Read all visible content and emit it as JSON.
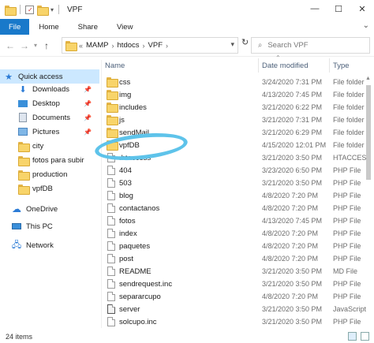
{
  "window": {
    "title": "VPF",
    "controls": {
      "minimize": "—",
      "maximize": "☐",
      "close": "✕"
    }
  },
  "ribbon": {
    "tabs": [
      "File",
      "Home",
      "Share",
      "View"
    ],
    "expand_icon": "chevron-down"
  },
  "address": {
    "back": "←",
    "forward": "→",
    "up": "↑",
    "breadcrumb_overflow": "«",
    "crumbs": [
      "MAMP",
      "htdocs",
      "VPF"
    ],
    "search_placeholder": "Search VPF"
  },
  "nav": {
    "items": [
      {
        "label": "Quick access",
        "icon": "star",
        "selected": true,
        "pinned": false
      },
      {
        "label": "Downloads",
        "icon": "download",
        "pinned": true
      },
      {
        "label": "Desktop",
        "icon": "desktop",
        "pinned": true
      },
      {
        "label": "Documents",
        "icon": "documents",
        "pinned": true
      },
      {
        "label": "Pictures",
        "icon": "pictures",
        "pinned": true
      },
      {
        "label": "city",
        "icon": "folder",
        "pinned": false
      },
      {
        "label": "fotos para subir",
        "icon": "folder",
        "pinned": false
      },
      {
        "label": "production",
        "icon": "folder",
        "pinned": false
      },
      {
        "label": "vpfDB",
        "icon": "folder",
        "pinned": false
      },
      {
        "label": "OneDrive",
        "icon": "cloud",
        "pinned": false
      },
      {
        "label": "This PC",
        "icon": "computer",
        "pinned": false
      },
      {
        "label": "Network",
        "icon": "network",
        "pinned": false
      }
    ]
  },
  "list": {
    "columns": {
      "name": "Name",
      "date": "Date modified",
      "type": "Type"
    },
    "files": [
      {
        "name": "css",
        "date": "3/24/2020 7:31 PM",
        "type": "File folder",
        "kind": "folder"
      },
      {
        "name": "img",
        "date": "4/13/2020 7:45 PM",
        "type": "File folder",
        "kind": "folder"
      },
      {
        "name": "includes",
        "date": "3/21/2020 6:22 PM",
        "type": "File folder",
        "kind": "folder"
      },
      {
        "name": "js",
        "date": "3/21/2020 7:31 PM",
        "type": "File folder",
        "kind": "folder"
      },
      {
        "name": "sendMail",
        "date": "3/21/2020 6:29 PM",
        "type": "File folder",
        "kind": "folder"
      },
      {
        "name": "vpfDB",
        "date": "4/15/2020 12:01 PM",
        "type": "File folder",
        "kind": "folder"
      },
      {
        "name": ".htaccess",
        "date": "3/21/2020 3:50 PM",
        "type": "HTACCESS",
        "kind": "file"
      },
      {
        "name": "404",
        "date": "3/23/2020 6:50 PM",
        "type": "PHP File",
        "kind": "file"
      },
      {
        "name": "503",
        "date": "3/21/2020 3:50 PM",
        "type": "PHP File",
        "kind": "file"
      },
      {
        "name": "blog",
        "date": "4/8/2020 7:20 PM",
        "type": "PHP File",
        "kind": "file"
      },
      {
        "name": "contactanos",
        "date": "4/8/2020 7:20 PM",
        "type": "PHP File",
        "kind": "file"
      },
      {
        "name": "fotos",
        "date": "4/13/2020 7:45 PM",
        "type": "PHP File",
        "kind": "file"
      },
      {
        "name": "index",
        "date": "4/8/2020 7:20 PM",
        "type": "PHP File",
        "kind": "file"
      },
      {
        "name": "paquetes",
        "date": "4/8/2020 7:20 PM",
        "type": "PHP File",
        "kind": "file"
      },
      {
        "name": "post",
        "date": "4/8/2020 7:20 PM",
        "type": "PHP File",
        "kind": "file"
      },
      {
        "name": "README",
        "date": "3/21/2020 3:50 PM",
        "type": "MD File",
        "kind": "file"
      },
      {
        "name": "sendrequest.inc",
        "date": "3/21/2020 3:50 PM",
        "type": "PHP File",
        "kind": "file"
      },
      {
        "name": "separarcupo",
        "date": "4/8/2020 7:20 PM",
        "type": "PHP File",
        "kind": "file"
      },
      {
        "name": "server",
        "date": "3/21/2020 3:50 PM",
        "type": "JavaScript",
        "kind": "file"
      },
      {
        "name": "solcupo.inc",
        "date": "3/21/2020 3:50 PM",
        "type": "PHP File",
        "kind": "file"
      }
    ]
  },
  "status": {
    "item_count": "24 items"
  },
  "colors": {
    "accent": "#1979ca",
    "selected": "#cce8ff",
    "folder": "#f8d46a",
    "highlight": "#5ec3ea"
  }
}
